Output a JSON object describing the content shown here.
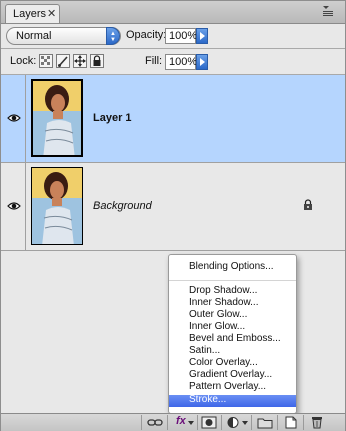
{
  "panel": {
    "tab_label": "Layers",
    "close_glyph": "✕",
    "menu_glyph": "▾≡"
  },
  "blend": {
    "mode": "Normal",
    "opacity_label": "Opacity:",
    "opacity_value": "100%"
  },
  "locks": {
    "lock_label": "Lock:",
    "fill_label": "Fill:",
    "fill_value": "100%"
  },
  "layers": [
    {
      "name": "Layer 1",
      "selected": true,
      "visible": true
    },
    {
      "name": "Background",
      "selected": false,
      "visible": true,
      "locked": true
    }
  ],
  "fx_menu": {
    "items": [
      "Blending Options...",
      "Drop Shadow...",
      "Inner Shadow...",
      "Outer Glow...",
      "Inner Glow...",
      "Bevel and Emboss...",
      "Satin...",
      "Color Overlay...",
      "Gradient Overlay...",
      "Pattern Overlay...",
      "Stroke..."
    ],
    "highlighted": "Stroke..."
  },
  "toolbar": {
    "fx_label": "fx",
    "icons": [
      "link-icon",
      "fx-icon",
      "mask-icon",
      "adjustment-icon",
      "group-icon",
      "new-layer-icon",
      "trash-icon"
    ]
  },
  "colors": {
    "selection": "#b5d5fe",
    "menu_highlight": "#3e66e8",
    "accent_blue": "#2c69c8"
  }
}
